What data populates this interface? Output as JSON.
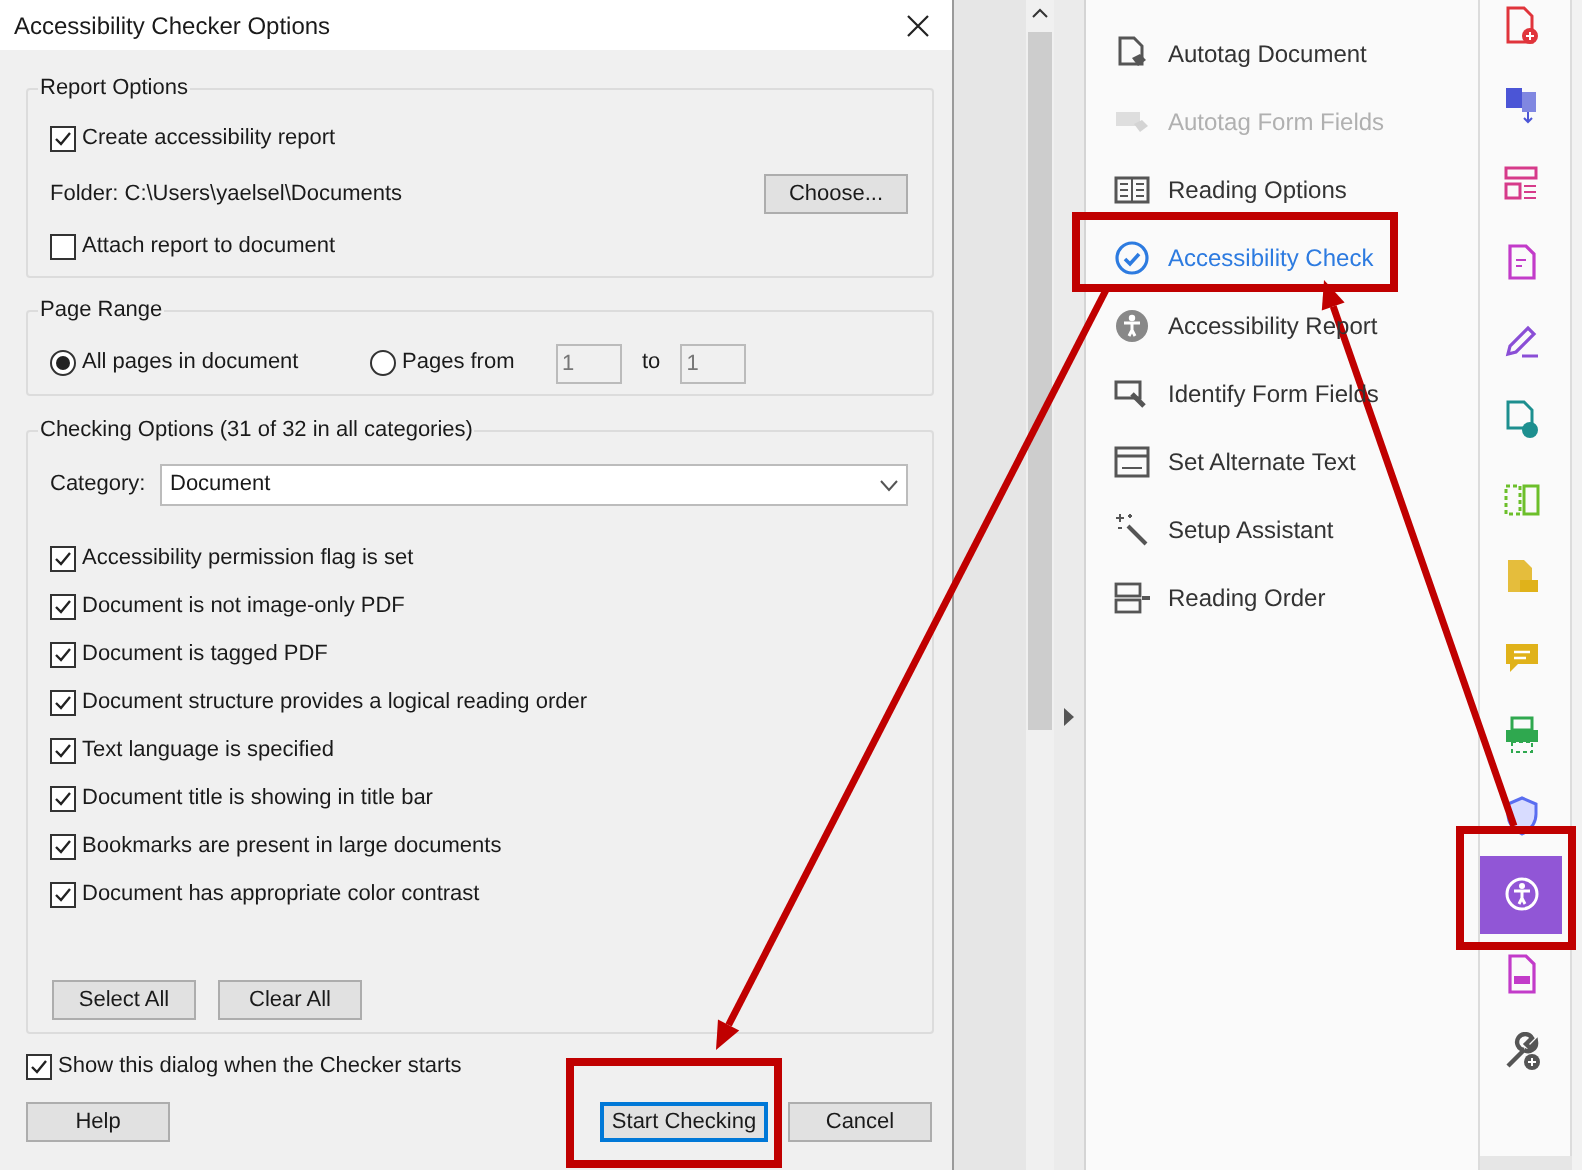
{
  "dialog": {
    "title": "Accessibility Checker Options",
    "report_options": {
      "legend": "Report Options",
      "create_report": {
        "label": "Create accessibility report",
        "checked": true
      },
      "folder_label": "Folder:",
      "folder_path": "C:\\Users\\yaelsel\\Documents",
      "choose_button": "Choose...",
      "attach_report": {
        "label": "Attach report to document",
        "checked": false
      }
    },
    "page_range": {
      "legend": "Page Range",
      "options": [
        {
          "label": "All pages in document",
          "selected": true
        },
        {
          "label": "Pages from",
          "selected": false
        }
      ],
      "from_value": "1",
      "to_label": "to",
      "to_value": "1"
    },
    "checking_options": {
      "legend": "Checking Options (31 of 32 in all categories)",
      "category_label": "Category:",
      "category_value": "Document",
      "checks": [
        {
          "label": "Accessibility permission flag is set",
          "checked": true
        },
        {
          "label": "Document is not image-only PDF",
          "checked": true
        },
        {
          "label": "Document is tagged PDF",
          "checked": true
        },
        {
          "label": "Document structure provides a logical reading order",
          "checked": true
        },
        {
          "label": "Text language is specified",
          "checked": true
        },
        {
          "label": "Document title is showing in title bar",
          "checked": true
        },
        {
          "label": "Bookmarks are present in large documents",
          "checked": true
        },
        {
          "label": "Document has appropriate color contrast",
          "checked": true
        }
      ],
      "buttons": [
        "Select All",
        "Clear All"
      ]
    },
    "show_dialog": {
      "label": "Show this dialog when the Checker starts",
      "checked": true
    },
    "buttons": [
      {
        "label": "Help",
        "default": false
      },
      {
        "label": "Start Checking",
        "default": true
      },
      {
        "label": "Cancel",
        "default": false
      }
    ]
  },
  "tools_panel": {
    "items": [
      {
        "kind": "autotag",
        "label": "Autotag Document",
        "disabled": false,
        "selected": false
      },
      {
        "kind": "formtag",
        "label": "Autotag Form Fields",
        "disabled": true,
        "selected": false
      },
      {
        "kind": "book",
        "label": "Reading Options",
        "disabled": false,
        "selected": false
      },
      {
        "kind": "check",
        "label": "Accessibility Check",
        "disabled": false,
        "selected": true
      },
      {
        "kind": "person",
        "label": "Accessibility Report",
        "disabled": false,
        "selected": false
      },
      {
        "kind": "identify",
        "label": "Identify Form Fields",
        "disabled": false,
        "selected": false
      },
      {
        "kind": "alttext",
        "label": "Set Alternate Text",
        "disabled": false,
        "selected": false
      },
      {
        "kind": "wand",
        "label": "Setup Assistant",
        "disabled": false,
        "selected": false
      },
      {
        "kind": "order",
        "label": "Reading Order",
        "disabled": false,
        "selected": false
      }
    ]
  },
  "tool_rail": [
    {
      "kind": "create",
      "selected": false
    },
    {
      "kind": "export",
      "selected": false
    },
    {
      "kind": "organize",
      "selected": false
    },
    {
      "kind": "form",
      "selected": false
    },
    {
      "kind": "sign",
      "selected": false
    },
    {
      "kind": "share",
      "selected": false
    },
    {
      "kind": "compare",
      "selected": false
    },
    {
      "kind": "scan",
      "selected": false
    },
    {
      "kind": "comment",
      "selected": false
    },
    {
      "kind": "print",
      "selected": false
    },
    {
      "kind": "protect",
      "selected": false
    },
    {
      "kind": "accessibility",
      "selected": true
    },
    {
      "kind": "redact",
      "selected": false
    },
    {
      "kind": "more",
      "selected": false
    }
  ]
}
